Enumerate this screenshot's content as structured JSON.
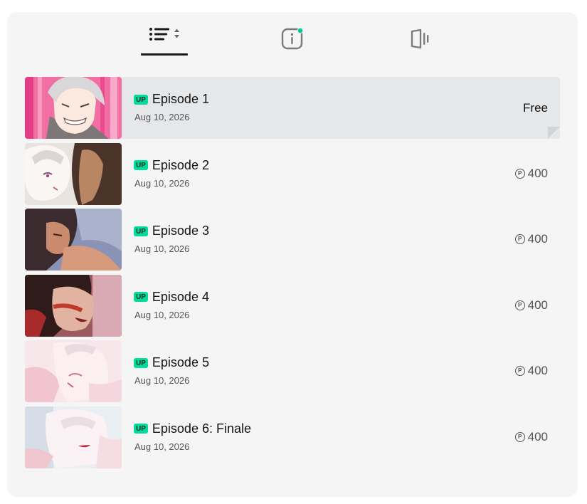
{
  "tabs": [
    {
      "name": "episode-list",
      "icon": "sort-list-icon",
      "active": true
    },
    {
      "name": "info",
      "icon": "info-icon",
      "badge_color": "#00c896"
    },
    {
      "name": "reader",
      "icon": "viewer-icon"
    }
  ],
  "badge_text": "UP",
  "accent_color": "#00dc9c",
  "episodes": [
    {
      "title": "Episode 1",
      "date": "Aug 10, 2026",
      "price": "Free",
      "selected": true
    },
    {
      "title": "Episode 2",
      "date": "Aug 10, 2026",
      "price": "400"
    },
    {
      "title": "Episode 3",
      "date": "Aug 10, 2026",
      "price": "400"
    },
    {
      "title": "Episode 4",
      "date": "Aug 10, 2026",
      "price": "400"
    },
    {
      "title": "Episode 5",
      "date": "Aug 10, 2026",
      "price": "400"
    },
    {
      "title": "Episode 6: Finale",
      "date": "Aug 10, 2026",
      "price": "400"
    }
  ],
  "coin_symbol": "P"
}
